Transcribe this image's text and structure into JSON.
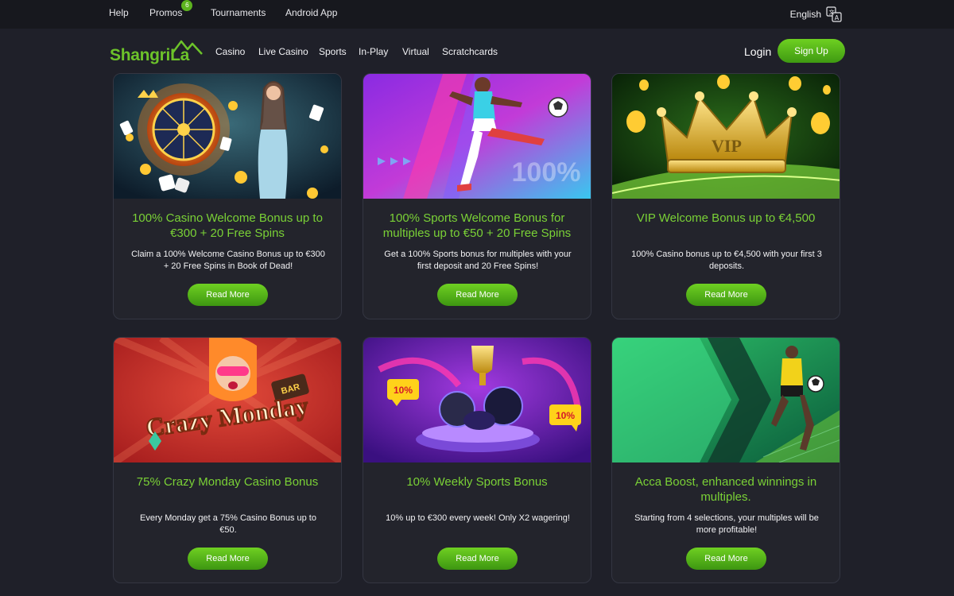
{
  "topbar": {
    "links": [
      "Help",
      "Promos",
      "Tournaments",
      "Android App"
    ],
    "promos_badge": "6",
    "language": "English"
  },
  "nav": {
    "logo_text": "ShangriLa",
    "links": [
      "Casino",
      "Live Casino",
      "Sports",
      "In-Play",
      "Virtual",
      "Scratchcards"
    ],
    "login": "Login",
    "signup": "Sign Up"
  },
  "colors": {
    "accent": "#6dc32a",
    "background": "#1f2029",
    "card": "#23242c"
  },
  "promos": [
    {
      "title": "100% Casino Welcome Bonus up to €300 + 20 Free Spins",
      "description": "Claim a 100% Welcome Casino Bonus up to €300 + 20 Free Spins in Book of Dead!",
      "button": "Read More"
    },
    {
      "title": "100% Sports Welcome Bonus for multiples up to €50 + 20 Free Spins",
      "description": "Get a 100% Sports bonus for multiples with your first deposit and 20 Free Spins!",
      "button": "Read More",
      "image_text": "100%"
    },
    {
      "title": "VIP Welcome Bonus up to €4,500",
      "description": "100% Casino bonus up to €4,500 with your first 3 deposits.",
      "button": "Read More",
      "image_text": "VIP"
    },
    {
      "title": "75% Crazy Monday Casino Bonus",
      "description": "Every Monday get a 75% Casino Bonus up to €50.",
      "button": "Read More",
      "image_text": "Crazy Monday",
      "image_text_2": "BAR"
    },
    {
      "title": "10% Weekly Sports Bonus",
      "description": "10% up to €300 every week! Only X2 wagering!",
      "button": "Read More",
      "image_text": "10%"
    },
    {
      "title": "Acca Boost, enhanced winnings in multiples.",
      "description": "Starting from 4 selections, your multiples will be more profitable!",
      "button": "Read More"
    }
  ]
}
